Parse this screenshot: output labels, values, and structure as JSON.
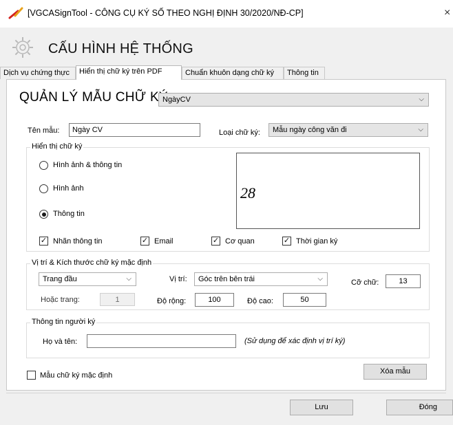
{
  "window": {
    "title": "[VGCASignTool - CÔNG CỤ KÝ SỐ THEO NGHỊ ĐỊNH 30/2020/NĐ-CP]",
    "close_label": "×"
  },
  "header": {
    "title": "CẤU HÌNH HỆ THỐNG"
  },
  "tabs": [
    "Dịch vụ chứng thực",
    "Hiển thị chữ ký trên PDF",
    "Chuẩn khuôn dạng chữ ký",
    "Thông tin"
  ],
  "manager": {
    "label": "QUẢN LÝ MẪU CHỮ KÝ:",
    "selected": "NgàyCV"
  },
  "template": {
    "name_label": "Tên mẫu:",
    "name_value": "Ngày CV",
    "type_label": "Loại chữ ký:",
    "type_value": "Mẫu ngày công văn đi"
  },
  "display_group": {
    "legend": "Hiển thị chữ ký",
    "radio_image_info": "Hình ảnh & thông tin",
    "radio_image": "Hình ảnh",
    "radio_info": "Thông tin",
    "selected": "Thông tin",
    "preview_text": "28",
    "chk_label": "Nhãn thông tin",
    "chk_email": "Email",
    "chk_org": "Cơ quan",
    "chk_time": "Thời gian ký",
    "check_mark": "✓"
  },
  "position_group": {
    "legend": "Vị trí  & Kích thước chữ ký mặc định",
    "page_value": "Trang đầu",
    "pos_label": "Vị trí:",
    "pos_value": "Góc trên bên trái",
    "font_size_label": "Cỡ chữ:",
    "font_size_value": "13",
    "or_page_label": "Hoặc trang:",
    "or_page_value": "1",
    "width_label": "Độ rộng:",
    "width_value": "100",
    "height_label": "Độ cao:",
    "height_value": "50"
  },
  "signer_group": {
    "legend": "Thông tin người ký",
    "name_label": "Họ và tên:",
    "name_value": "",
    "note": "(Sử dụng để xác định vị trí ký)"
  },
  "default_checkbox": "Mẫu chữ ký mặc định",
  "buttons": {
    "delete": "Xóa mẫu",
    "save": "Lưu",
    "close": "Đóng"
  },
  "icons": {
    "chevron": "⌵"
  }
}
